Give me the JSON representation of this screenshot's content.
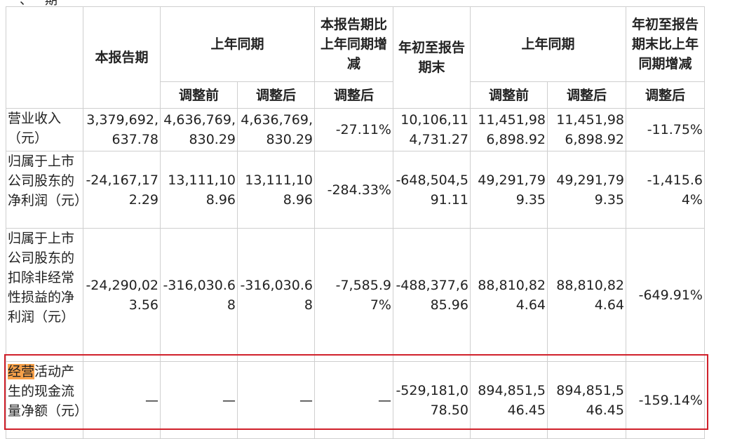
{
  "top_fragment": "一、一期",
  "header": {
    "col_current_period": "本报告期",
    "col_prev_same_period_1": "上年同期",
    "col_change_1": "本报告期比上年同期增减",
    "col_ytd": "年初至报告期末",
    "col_prev_same_period_2": "上年同期",
    "col_change_2": "年初至报告期末比上年同期增减",
    "sub_before_adj_1": "调整前",
    "sub_after_adj_1": "调整后",
    "sub_change_after_1": "调整后",
    "sub_before_adj_2": "调整前",
    "sub_after_adj_2": "调整后",
    "sub_change_after_2": "调整后"
  },
  "rows": [
    {
      "label": "营业收入（元）",
      "cells": [
        "3,379,692,637.78",
        "4,636,769,830.29",
        "4,636,769,830.29",
        "-27.11%",
        "10,106,114,731.27",
        "11,451,986,898.92",
        "11,451,986,898.92",
        "-11.75%"
      ]
    },
    {
      "label": "归属于上市公司股东的净利润（元）",
      "cells": [
        "-24,167,172.29",
        "13,111,108.96",
        "13,111,108.96",
        "-284.33%",
        "-648,504,591.11",
        "49,291,799.35",
        "49,291,799.35",
        "-1,415.64%"
      ]
    },
    {
      "label": "归属于上市公司股东的扣除非经常性损益的净利润（元）",
      "cells": [
        "-24,290,023.56",
        "-316,030.68",
        "-316,030.68",
        "-7,585.97%",
        "-488,377,685.96",
        "88,810,824.64",
        "88,810,824.64",
        "-649.91%"
      ]
    },
    {
      "label_highlight": "经营",
      "label_rest": "活动产生的现金流量净额（元）",
      "cells": [
        "—",
        "—",
        "—",
        "—",
        "-529,181,078.50",
        "894,851,546.45",
        "894,851,546.45",
        "-159.14%"
      ]
    }
  ],
  "highlight_color": "#f7a14a",
  "box_color": "#d0202a"
}
